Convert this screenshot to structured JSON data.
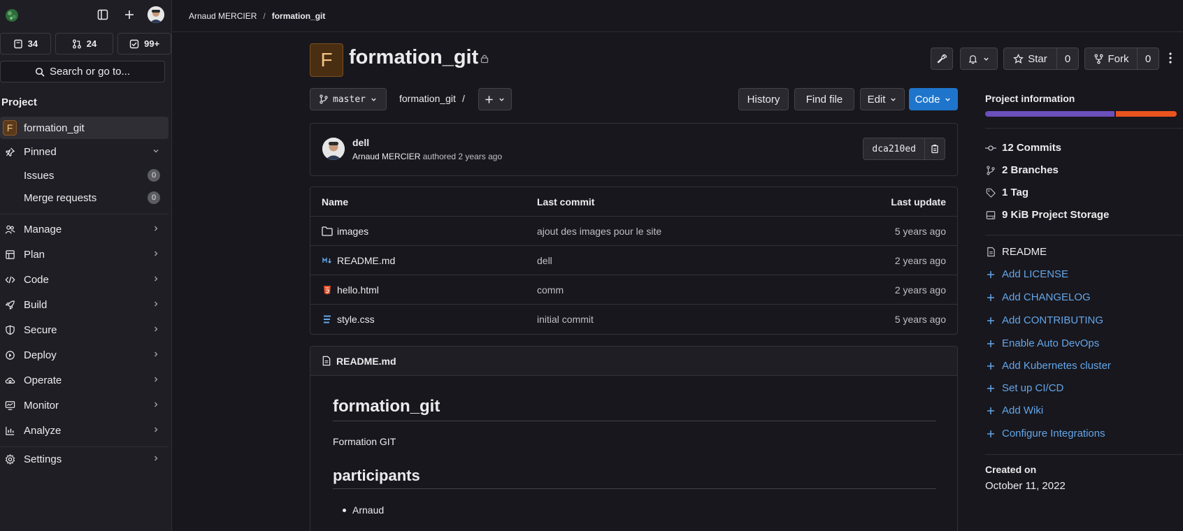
{
  "breadcrumb": {
    "owner": "Arnaud MERCIER",
    "separator": "/",
    "project": "formation_git"
  },
  "sidebar": {
    "counts": {
      "issues": "34",
      "merge_requests": "24",
      "todos": "99+"
    },
    "search_label": "Search or go to...",
    "section_title": "Project",
    "project_letter": "F",
    "project_name": "formation_git",
    "pinned_label": "Pinned",
    "pinned_items": [
      {
        "label": "Issues",
        "count": "0"
      },
      {
        "label": "Merge requests",
        "count": "0"
      }
    ],
    "menu": [
      {
        "label": "Manage"
      },
      {
        "label": "Plan"
      },
      {
        "label": "Code"
      },
      {
        "label": "Build"
      },
      {
        "label": "Secure"
      },
      {
        "label": "Deploy"
      },
      {
        "label": "Operate"
      },
      {
        "label": "Monitor"
      },
      {
        "label": "Analyze"
      },
      {
        "label": "Settings"
      }
    ]
  },
  "project": {
    "letter": "F",
    "title": "formation_git",
    "star_label": "Star",
    "star_count": "0",
    "fork_label": "Fork",
    "fork_count": "0"
  },
  "toolbar": {
    "branch": "master",
    "path": "formation_git",
    "path_sep": "/",
    "history": "History",
    "find_file": "Find file",
    "edit": "Edit",
    "code": "Code"
  },
  "commit": {
    "title": "dell",
    "author": "Arnaud MERCIER",
    "authored": "authored 2 years ago",
    "sha": "dca210ed"
  },
  "files": {
    "headers": {
      "name": "Name",
      "last_commit": "Last commit",
      "last_update": "Last update"
    },
    "rows": [
      {
        "name": "images",
        "commit": "ajout des images pour le site",
        "updated": "5 years ago"
      },
      {
        "name": "README.md",
        "commit": "dell",
        "updated": "2 years ago"
      },
      {
        "name": "hello.html",
        "commit": "comm",
        "updated": "2 years ago"
      },
      {
        "name": "style.css",
        "commit": "initial commit",
        "updated": "5 years ago"
      }
    ]
  },
  "readme": {
    "filename": "README.md",
    "h1": "formation_git",
    "paragraph": "Formation GIT",
    "h2": "participants",
    "list": [
      "Arnaud"
    ]
  },
  "info": {
    "title": "Project information",
    "language_bar": [
      {
        "color": "#6b4fbb",
        "percent": 68
      },
      {
        "color": "#e9541e",
        "percent": 32
      }
    ],
    "commits": "12 Commits",
    "branches": "2 Branches",
    "tags": "1 Tag",
    "storage": "9 KiB Project Storage",
    "readme": "README",
    "links": [
      "Add LICENSE",
      "Add CHANGELOG",
      "Add CONTRIBUTING",
      "Enable Auto DevOps",
      "Add Kubernetes cluster",
      "Set up CI/CD",
      "Add Wiki",
      "Configure Integrations"
    ],
    "created_label": "Created on",
    "created_date": "October 11, 2022"
  },
  "colors": {
    "accent": "#1f75cb",
    "link": "#63a6e9",
    "background": "#18171d"
  }
}
